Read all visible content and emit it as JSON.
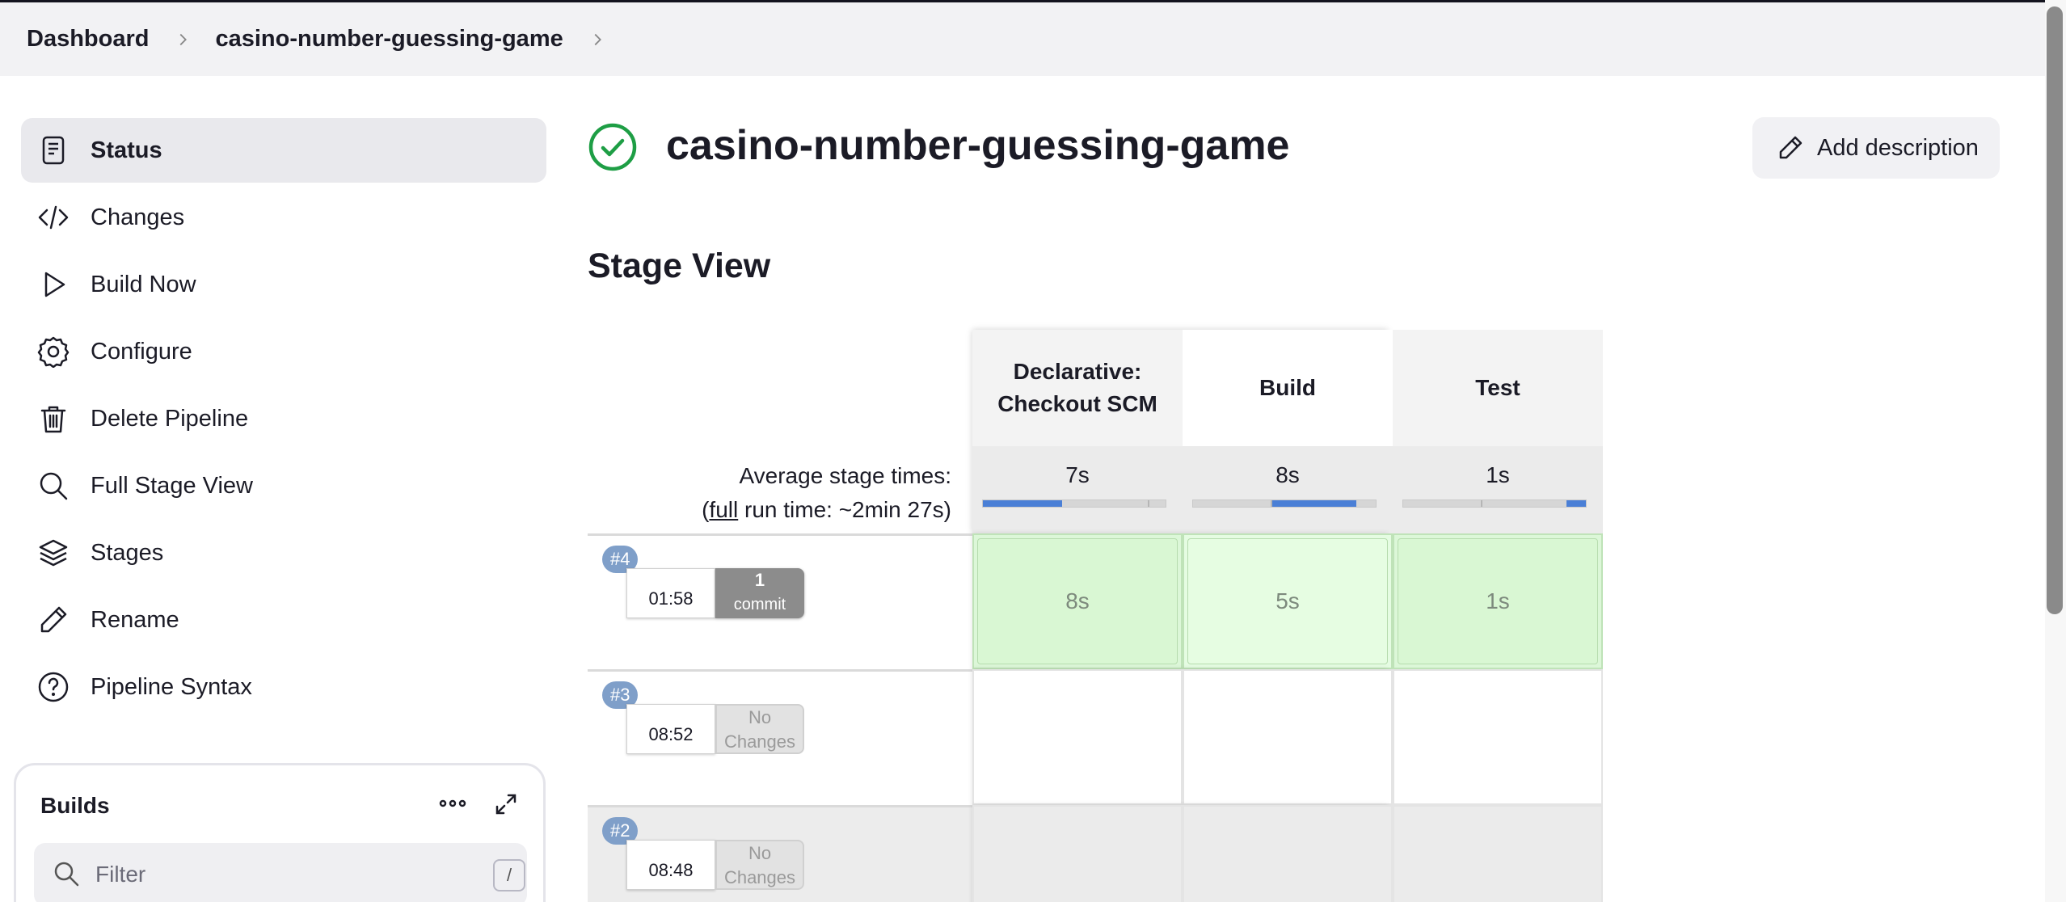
{
  "breadcrumb": {
    "items": [
      "Dashboard",
      "casino-number-guessing-game"
    ]
  },
  "sidebar": {
    "items": [
      {
        "label": "Status",
        "icon": "document-icon",
        "active": true
      },
      {
        "label": "Changes",
        "icon": "code-icon"
      },
      {
        "label": "Build Now",
        "icon": "play-icon"
      },
      {
        "label": "Configure",
        "icon": "gear-icon"
      },
      {
        "label": "Delete Pipeline",
        "icon": "trash-icon"
      },
      {
        "label": "Full Stage View",
        "icon": "search-icon"
      },
      {
        "label": "Stages",
        "icon": "layers-icon"
      },
      {
        "label": "Rename",
        "icon": "pencil-icon"
      },
      {
        "label": "Pipeline Syntax",
        "icon": "help-icon"
      }
    ]
  },
  "builds": {
    "title": "Builds",
    "filter_placeholder": "Filter",
    "filter_shortcut": "/"
  },
  "job": {
    "title": "casino-number-guessing-game",
    "status": "success",
    "add_description_label": "Add description"
  },
  "stage_view": {
    "title": "Stage View",
    "avg_label_line1": "Average stage times:",
    "avg_label_prefix": "(",
    "avg_label_link": "full",
    "avg_label_suffix": " run time: ~2min 27s)",
    "stages": [
      {
        "name": "Declarative: Checkout SCM",
        "avg": "7s"
      },
      {
        "name": "Build",
        "avg": "8s"
      },
      {
        "name": "Test",
        "avg": "1s"
      }
    ],
    "runs": [
      {
        "id": "#4",
        "time": "01:58",
        "changes_count": "1",
        "changes_label": "commit",
        "durations": [
          "8s",
          "5s",
          "1s"
        ]
      },
      {
        "id": "#3",
        "time": "08:52",
        "changes_label": "No Changes",
        "durations": [
          "",
          "",
          ""
        ]
      },
      {
        "id": "#2",
        "time": "08:48",
        "changes_label": "No Changes",
        "durations": [
          "",
          "",
          ""
        ]
      }
    ]
  },
  "colors": {
    "success": "#1e9e45",
    "progress": "#4a7fd6",
    "run_badge": "#7f9fc9"
  }
}
